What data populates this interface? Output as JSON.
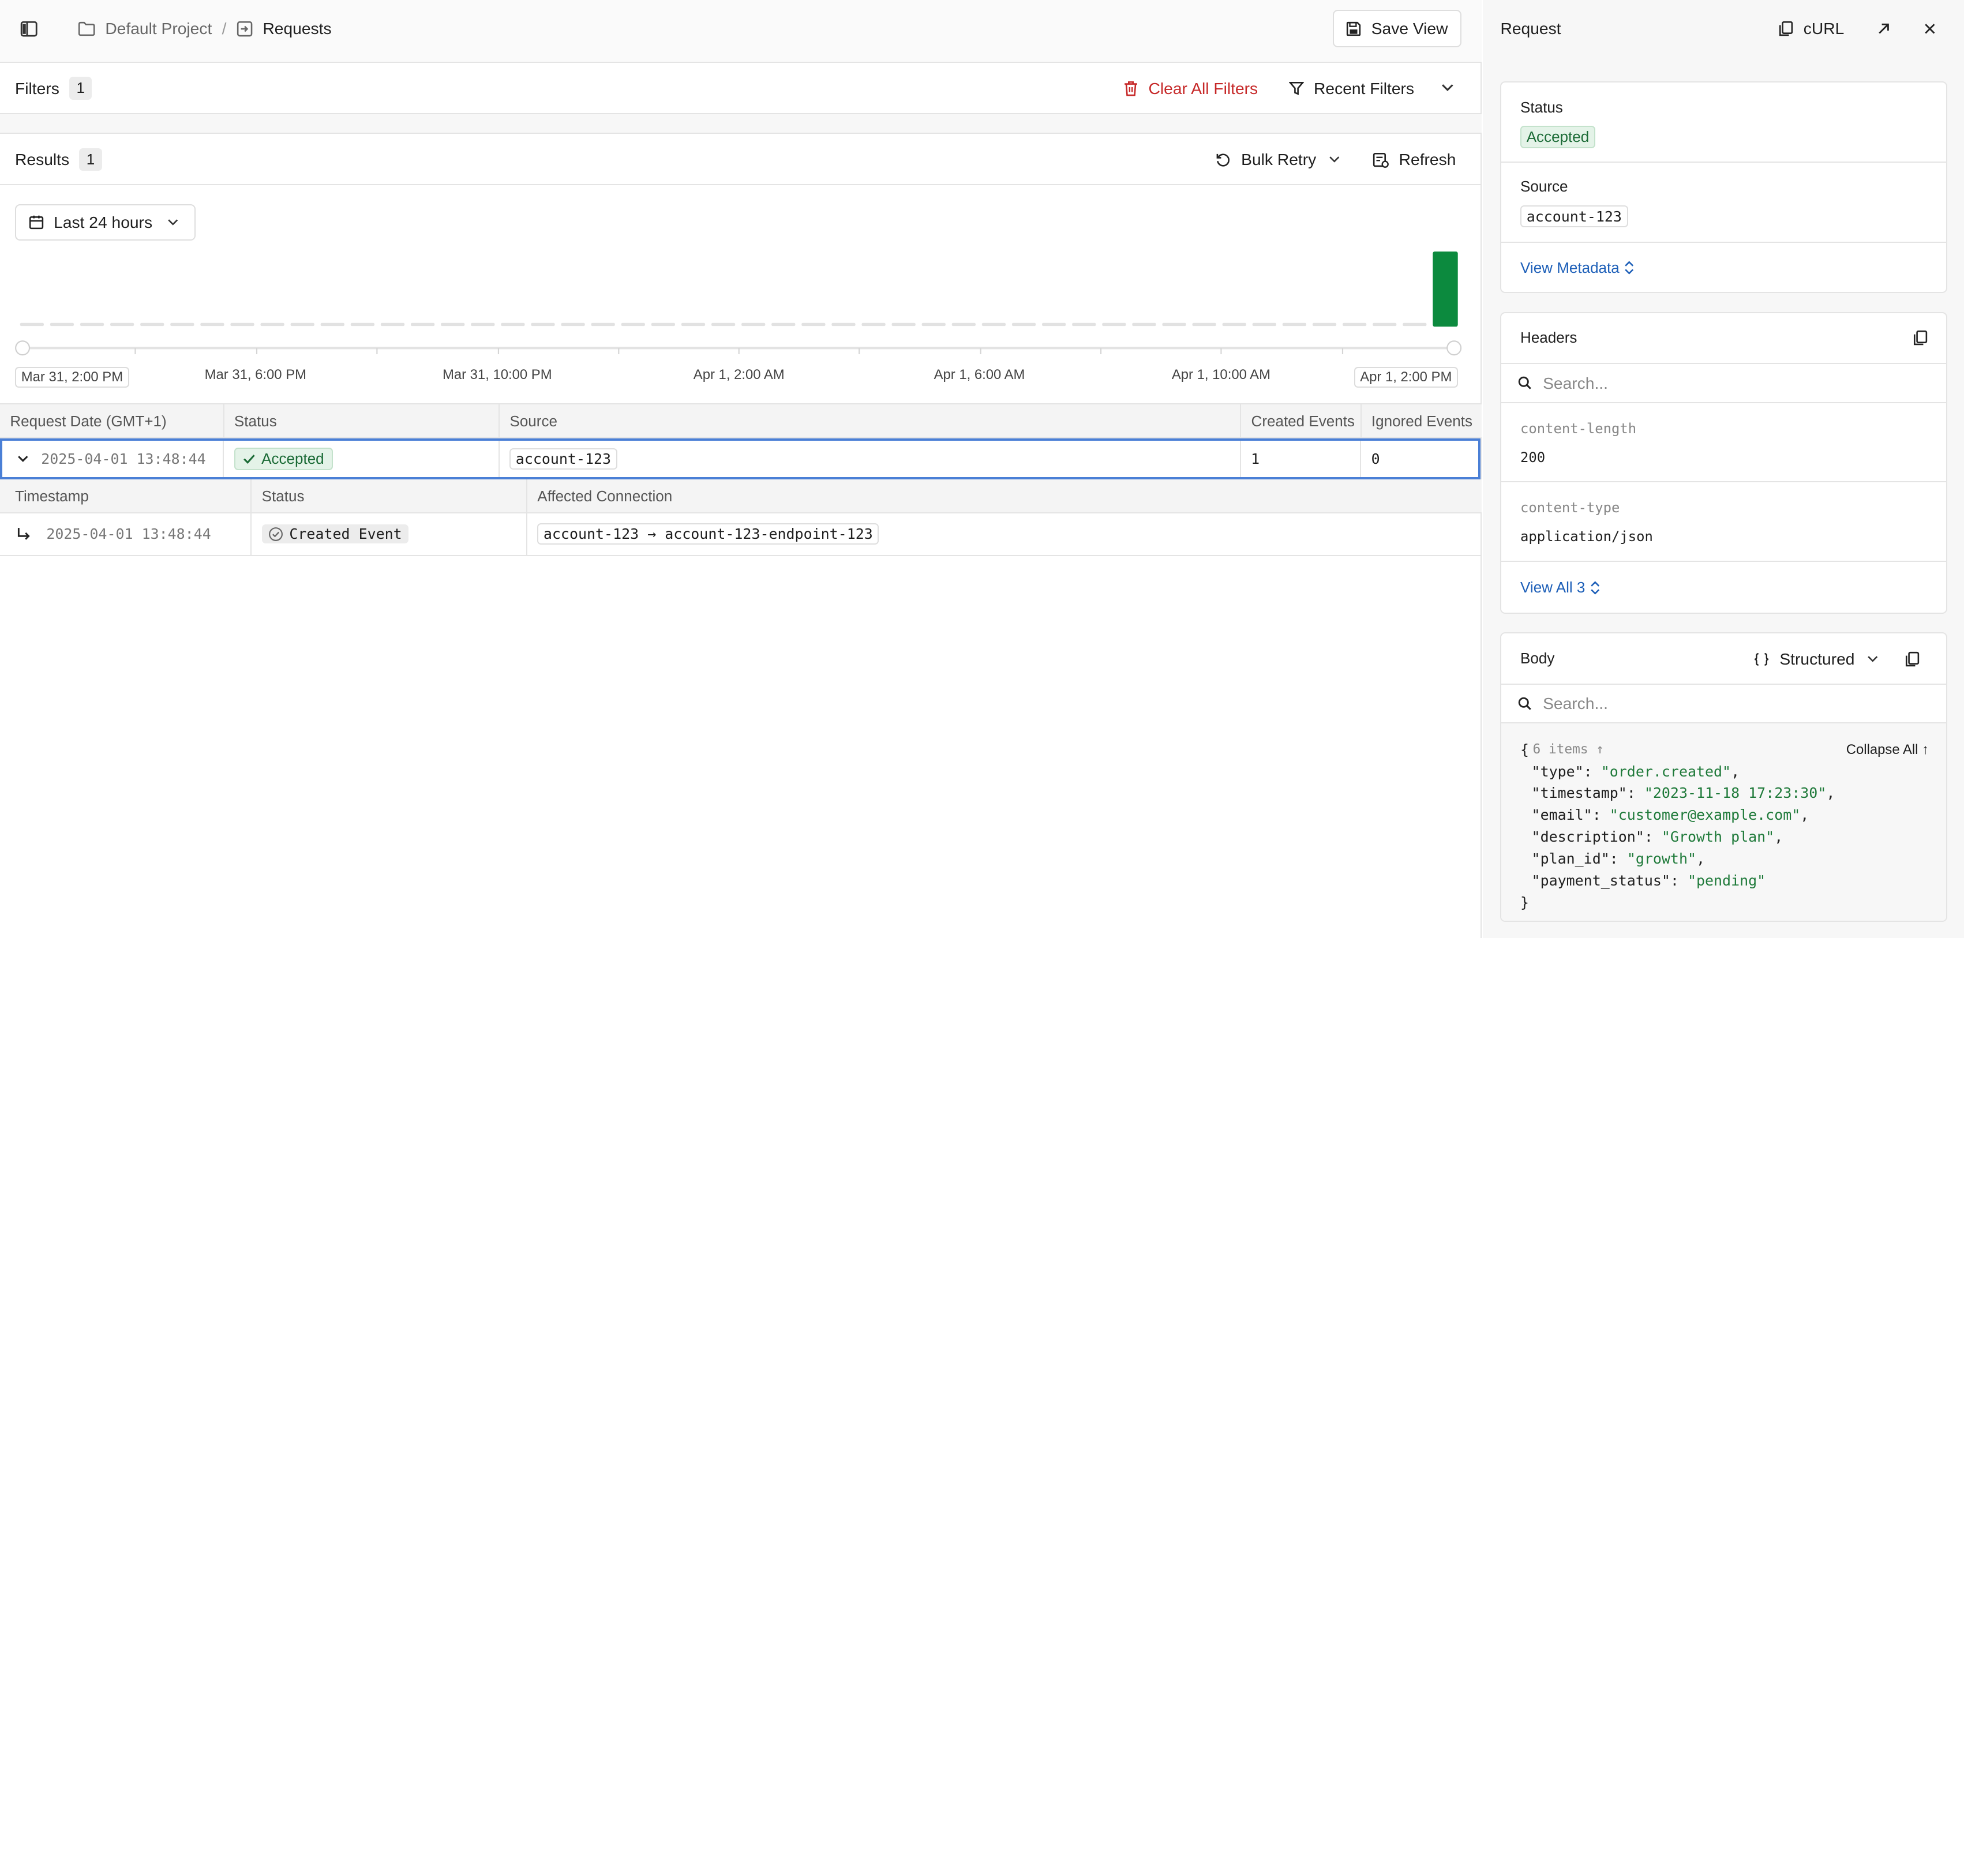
{
  "breadcrumb": {
    "project": "Default Project",
    "separator": "/",
    "page": "Requests"
  },
  "toolbar": {
    "save_view": "Save View"
  },
  "filters": {
    "label": "Filters",
    "count": "1",
    "clear_all": "Clear All Filters",
    "recent": "Recent Filters"
  },
  "results": {
    "label": "Results",
    "count": "1",
    "bulk_retry": "Bulk Retry",
    "refresh": "Refresh"
  },
  "time_range": {
    "selected": "Last 24 hours"
  },
  "histogram": {
    "ticks": [
      "Mar 31, 2:00 PM",
      "Mar 31, 6:00 PM",
      "Mar 31, 10:00 PM",
      "Apr 1, 2:00 AM",
      "Apr 1, 6:00 AM",
      "Apr 1, 10:00 AM",
      "Apr 1, 2:00 PM"
    ],
    "bucket_counts": [
      0,
      0,
      0,
      0,
      0,
      0,
      0,
      0,
      0,
      0,
      0,
      0,
      0,
      0,
      0,
      0,
      0,
      0,
      0,
      0,
      0,
      0,
      0,
      0,
      0,
      0,
      0,
      0,
      0,
      0,
      0,
      0,
      0,
      0,
      0,
      0,
      0,
      0,
      0,
      0,
      0,
      0,
      0,
      0,
      0,
      0,
      0,
      1
    ],
    "bar_color": "#0c8a3e"
  },
  "table": {
    "columns": [
      "Request Date (GMT+1)",
      "Status",
      "Source",
      "Created Events",
      "Ignored Events"
    ],
    "row": {
      "date": "2025-04-01 13:48:44",
      "status": "Accepted",
      "source": "account-123",
      "created": "1",
      "ignored": "0"
    },
    "sub_columns": [
      "Timestamp",
      "Status",
      "Affected Connection"
    ],
    "sub_row": {
      "timestamp": "2025-04-01 13:48:44",
      "status": "Created Event",
      "connection": "account-123 → account-123-endpoint-123"
    }
  },
  "panel": {
    "title": "Request",
    "curl": "cURL",
    "status_label": "Status",
    "status_value": "Accepted",
    "source_label": "Source",
    "source_value": "account-123",
    "view_metadata": "View Metadata",
    "headers_title": "Headers",
    "headers_search_placeholder": "Search...",
    "headers": [
      {
        "key": "content-length",
        "value": "200"
      },
      {
        "key": "content-type",
        "value": "application/json"
      }
    ],
    "view_all": "View All 3",
    "body_title": "Body",
    "body_mode": "Structured",
    "body_search_placeholder": "Search...",
    "body_meta": "6 items ↑",
    "collapse_all": "Collapse All ↑",
    "body_lines": [
      {
        "key": "\"type\"",
        "value": "\"order.created\""
      },
      {
        "key": "\"timestamp\"",
        "value": "\"2023-11-18 17:23:30\""
      },
      {
        "key": "\"email\"",
        "value": "\"customer@example.com\""
      },
      {
        "key": "\"description\"",
        "value": "\"Growth plan\""
      },
      {
        "key": "\"plan_id\"",
        "value": "\"growth\""
      },
      {
        "key": "\"payment_status\"",
        "value": "\"pending\""
      }
    ],
    "open_brace": "{",
    "close_brace": "}"
  },
  "colors": {
    "accent_link": "#1d5fb8",
    "danger": "#c62828",
    "success": "#1b6b36",
    "selection": "#4a7fd6"
  }
}
